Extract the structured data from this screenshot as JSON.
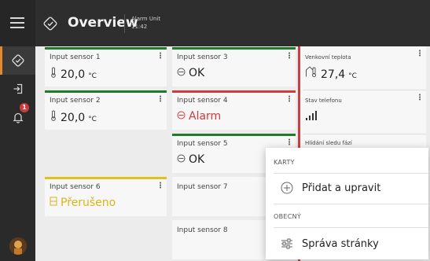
{
  "header": {
    "title": "Overview",
    "unit_name": "Alarm Unit",
    "time": "11:42"
  },
  "rail": {
    "icons": [
      "menu-icon",
      "overview-icon",
      "logout-icon",
      "bell-icon"
    ],
    "notification_count": "1"
  },
  "cards": [
    {
      "id": "input1",
      "name": "Input sensor 1",
      "value": "20,0",
      "unit": "°C",
      "status": "ok",
      "accent": "#1f7a2a"
    },
    {
      "id": "input2",
      "name": "Input sensor 2",
      "value": "20,0",
      "unit": "°C",
      "status": "ok",
      "accent": "#1f7a2a"
    },
    {
      "id": "input3",
      "name": "Input sensor 3",
      "value": "OK",
      "unit": "",
      "status": "ok",
      "accent": "#1f7a2a"
    },
    {
      "id": "input4",
      "name": "Input sensor 4",
      "value": "Alarm",
      "unit": "",
      "status": "alarm",
      "accent": "#d13b3b"
    },
    {
      "id": "input5",
      "name": "Input sensor 5",
      "value": "OK",
      "unit": "",
      "status": "ok",
      "accent": "#1f7a2a"
    },
    {
      "id": "input6",
      "name": "Input sensor 6",
      "value": "Přerušeno",
      "unit": "",
      "status": "interrupted",
      "accent": "#e0c21f"
    },
    {
      "id": "input7",
      "name": "Input sensor 7",
      "value": "",
      "unit": "",
      "status": "none"
    },
    {
      "id": "input8",
      "name": "Input sensor 8",
      "value": "",
      "unit": "",
      "status": "none"
    },
    {
      "id": "outdoor",
      "name": "Venkovní teplota",
      "value": "27,4",
      "unit": "°C",
      "status": "alarm",
      "accent": "#d13b3b"
    },
    {
      "id": "phone",
      "name": "Stav telefonu",
      "value": "",
      "unit": "",
      "status": "signal"
    },
    {
      "id": "phase",
      "name": "Hlídání sledu fází",
      "value": "",
      "unit": "",
      "status": "none"
    }
  ],
  "popup": {
    "section1": "KARTY",
    "item1": "Přidat a upravit",
    "item1_icon": "plus-circle-icon",
    "section2": "OBECNÝ",
    "item2": "Správa stránky",
    "item2_icon": "sliders-icon"
  },
  "colors": {
    "header_bg": "#2e2e2e",
    "rail_bg": "#2a2a2a",
    "ok_accent": "#1f7a2a",
    "alarm_accent": "#d13b3b",
    "interrupted_accent": "#e0c21f",
    "rail_active": "#e08a2c"
  }
}
